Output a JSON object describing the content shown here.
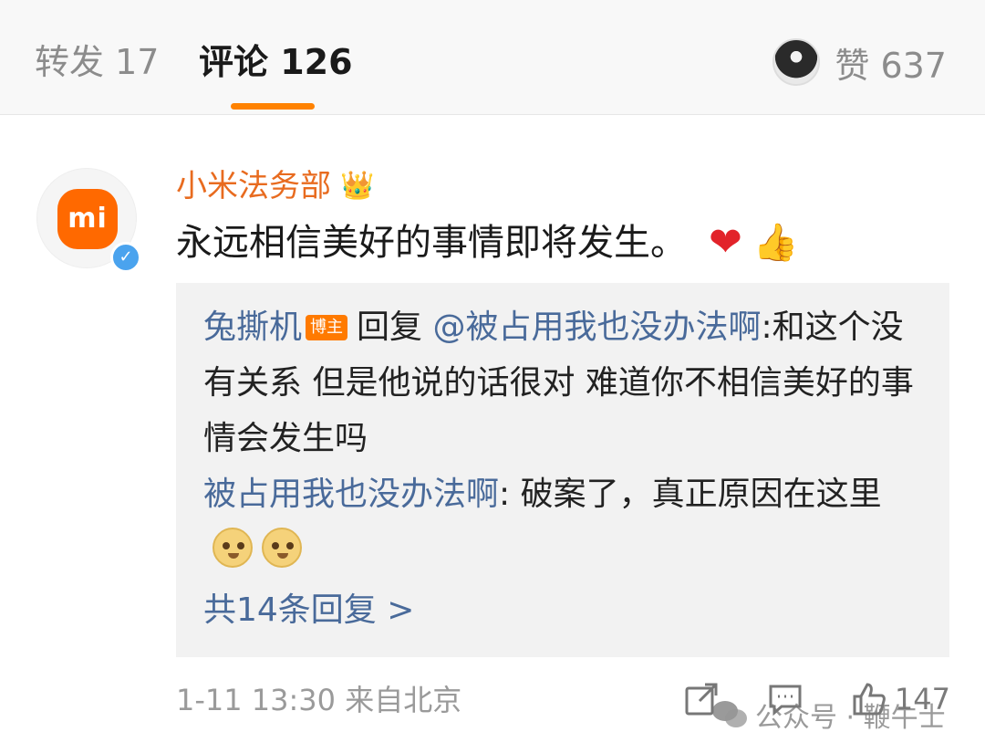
{
  "tabs": {
    "repost": "转发 17",
    "comments": "评论 126",
    "likes": "赞 637"
  },
  "comment": {
    "username": "小米法务部",
    "logo_text": "mi",
    "text": "永远相信美好的事情即将发生。",
    "timestamp": "1-11 13:30",
    "location": "来自北京",
    "like_count": "147"
  },
  "replies": [
    {
      "author": "兔撕机",
      "badge": "博主",
      "reply_word": "回复",
      "mention": "@被占用我也没办法啊",
      "text": ":和这个没有关系 但是他说的话很对 难道你不相信美好的事情会发生吗"
    },
    {
      "author": "被占用我也没办法啊",
      "text": ": 破案了，真正原因在这里"
    }
  ],
  "more_replies": "共14条回复 >",
  "watermark": {
    "text": "公众号 · 鞭牛士"
  },
  "icons": {
    "crown": "crown-icon",
    "heart": "heart-icon",
    "thumbs_up": "thumbs-up-icon",
    "doge": "doge-icon",
    "share": "share-icon",
    "comment": "comment-icon",
    "like": "like-icon"
  },
  "colors": {
    "accent": "#ff8200",
    "username": "#e86b1f",
    "link": "#496a9a",
    "verified": "#4aa3ee"
  }
}
